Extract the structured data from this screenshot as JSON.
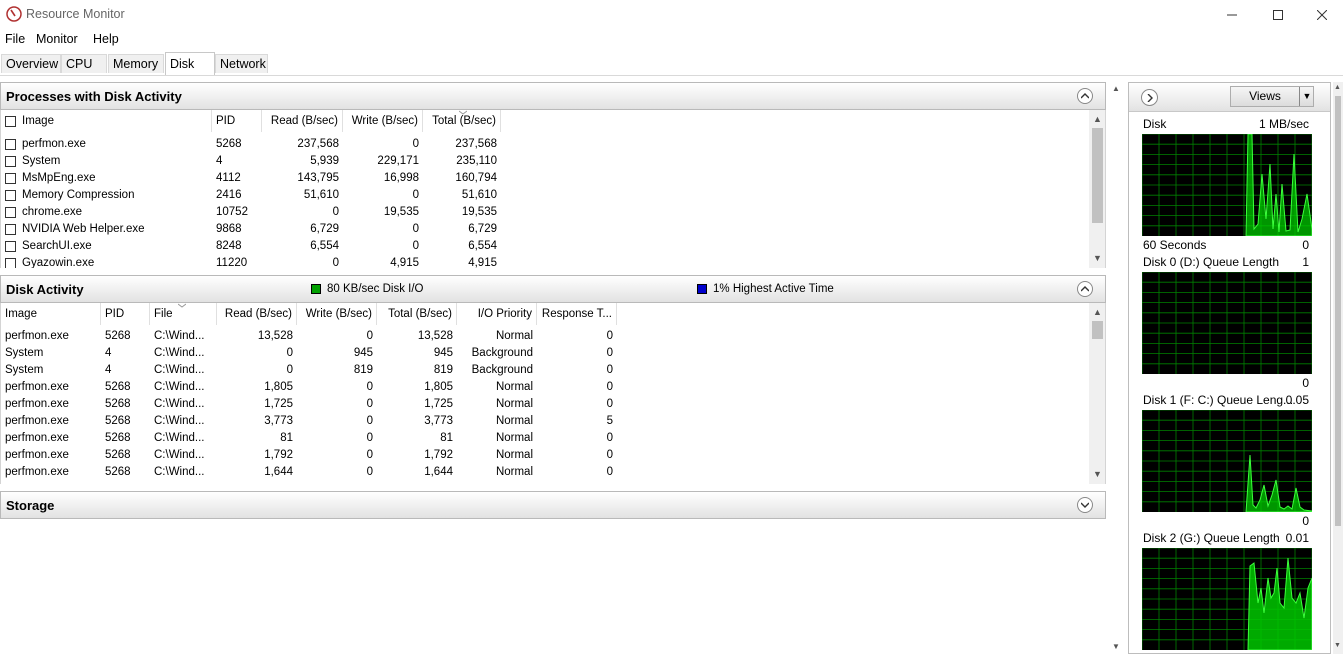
{
  "window": {
    "title": "Resource Monitor"
  },
  "menu": [
    "File",
    "Monitor",
    "Help"
  ],
  "tabs": [
    "Overview",
    "CPU",
    "Memory",
    "Disk",
    "Network"
  ],
  "active_tab": "Disk",
  "processes": {
    "title": "Processes with Disk Activity",
    "columns": [
      "Image",
      "PID",
      "Read (B/sec)",
      "Write (B/sec)",
      "Total (B/sec)"
    ],
    "rows": [
      [
        "perfmon.exe",
        "5268",
        "237,568",
        "0",
        "237,568"
      ],
      [
        "System",
        "4",
        "5,939",
        "229,171",
        "235,110"
      ],
      [
        "MsMpEng.exe",
        "4112",
        "143,795",
        "16,998",
        "160,794"
      ],
      [
        "Memory Compression",
        "2416",
        "51,610",
        "0",
        "51,610"
      ],
      [
        "chrome.exe",
        "10752",
        "0",
        "19,535",
        "19,535"
      ],
      [
        "NVIDIA Web Helper.exe",
        "9868",
        "6,729",
        "0",
        "6,729"
      ],
      [
        "SearchUI.exe",
        "8248",
        "6,554",
        "0",
        "6,554"
      ],
      [
        "Gyazowin.exe",
        "11220",
        "0",
        "4,915",
        "4,915"
      ]
    ]
  },
  "disk_activity": {
    "title": "Disk Activity",
    "io_legend": "80 KB/sec Disk I/O",
    "active_legend": "1% Highest Active Time",
    "colors": {
      "io": "#00a000",
      "active": "#0000cc"
    },
    "columns": [
      "Image",
      "PID",
      "File",
      "Read (B/sec)",
      "Write (B/sec)",
      "Total (B/sec)",
      "I/O Priority",
      "Response T..."
    ],
    "rows": [
      [
        "perfmon.exe",
        "5268",
        "C:\\Wind...",
        "13,528",
        "0",
        "13,528",
        "Normal",
        "0"
      ],
      [
        "System",
        "4",
        "C:\\Wind...",
        "0",
        "945",
        "945",
        "Background",
        "0"
      ],
      [
        "System",
        "4",
        "C:\\Wind...",
        "0",
        "819",
        "819",
        "Background",
        "0"
      ],
      [
        "perfmon.exe",
        "5268",
        "C:\\Wind...",
        "1,805",
        "0",
        "1,805",
        "Normal",
        "0"
      ],
      [
        "perfmon.exe",
        "5268",
        "C:\\Wind...",
        "1,725",
        "0",
        "1,725",
        "Normal",
        "0"
      ],
      [
        "perfmon.exe",
        "5268",
        "C:\\Wind...",
        "3,773",
        "0",
        "3,773",
        "Normal",
        "5"
      ],
      [
        "perfmon.exe",
        "5268",
        "C:\\Wind...",
        "81",
        "0",
        "81",
        "Normal",
        "0"
      ],
      [
        "perfmon.exe",
        "5268",
        "C:\\Wind...",
        "1,792",
        "0",
        "1,792",
        "Normal",
        "0"
      ],
      [
        "perfmon.exe",
        "5268",
        "C:\\Wind...",
        "1,644",
        "0",
        "1,644",
        "Normal",
        "0"
      ]
    ]
  },
  "storage": {
    "title": "Storage"
  },
  "graphs": {
    "views_label": "Views",
    "disk": {
      "title": "Disk",
      "scale": "1 MB/sec",
      "footer": "60 Seconds",
      "footer_val": "0"
    },
    "disk0": {
      "title": "Disk 0 (D:) Queue Length",
      "scale": "1",
      "zero": "0"
    },
    "disk1": {
      "title": "Disk 1 (F: C:) Queue Leng...",
      "scale": "0.05",
      "zero": "0"
    },
    "disk2": {
      "title": "Disk 2 (G:) Queue Length",
      "scale": "0.01"
    }
  },
  "icons": [
    "app-icon",
    "minimize-icon",
    "maximize-icon",
    "close-icon",
    "collapse-up-icon",
    "expand-down-icon",
    "expand-right-icon",
    "dropdown-arrow-icon",
    "sort-indicator-icon"
  ]
}
